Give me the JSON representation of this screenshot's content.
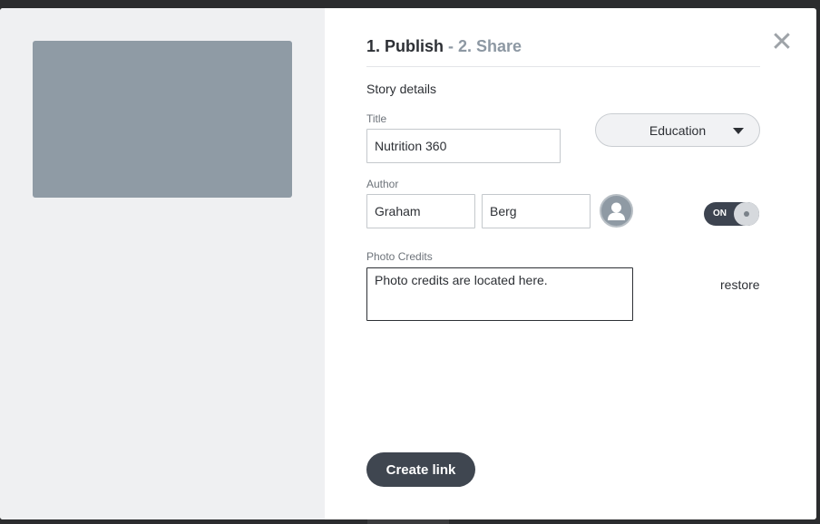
{
  "steps": {
    "step1": "1. Publish",
    "separator": " - ",
    "step2": "2. Share"
  },
  "close_icon": "close-icon",
  "story": {
    "section_title": "Story details",
    "title_label": "Title",
    "title_value": "Nutrition 360",
    "category_value": "Education",
    "author_label": "Author",
    "author_first": "Graham",
    "author_last": "Berg",
    "avatar_icon": "user-icon",
    "toggle_label": "ON",
    "credits_label": "Photo Credits",
    "credits_value": "Photo credits are located here.",
    "restore_label": "restore"
  },
  "actions": {
    "create_link_label": "Create link"
  },
  "colors": {
    "overlay": "#2b2c2e",
    "left_pane": "#eff0f2",
    "thumbnail": "#8f9ba5",
    "primary_button": "#3f4650",
    "muted_text": "#8d98a3"
  }
}
